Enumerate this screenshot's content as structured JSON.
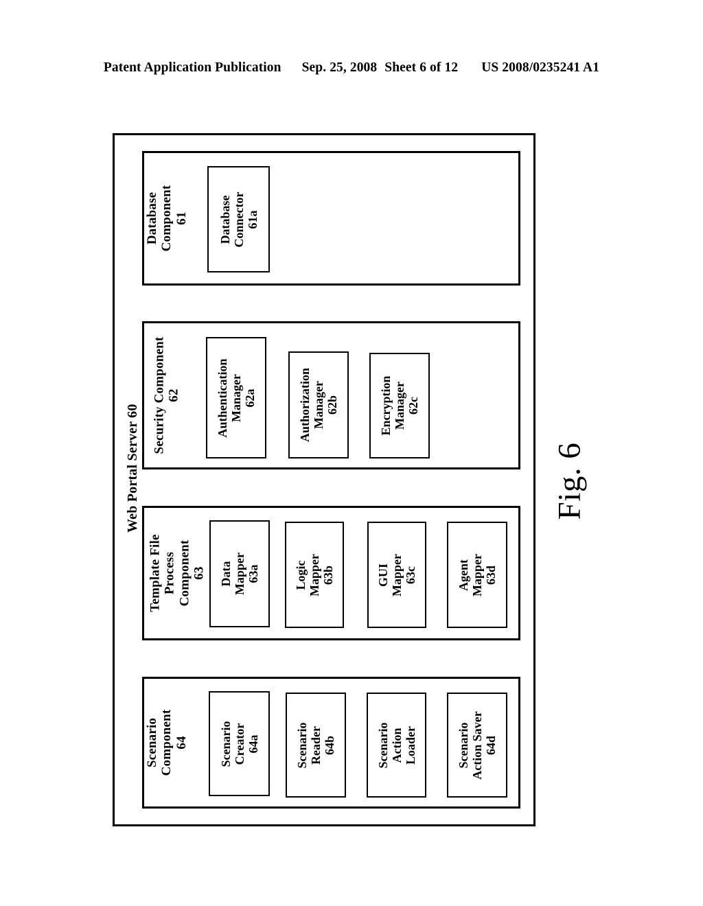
{
  "header": {
    "publication": "Patent Application Publication",
    "date": "Sep. 25, 2008",
    "sheet": "Sheet 6 of 12",
    "patent_number": "US 2008/0235241 A1"
  },
  "figure": {
    "caption": "Fig. 6",
    "outer_title": "Web Portal Server 60",
    "line_color": "#000000",
    "background": "#ffffff"
  },
  "sections": [
    {
      "title": "Database\nComponent\n61",
      "boxes": [
        {
          "label": "Database\nConnector\n61a"
        }
      ]
    },
    {
      "title": "Security Component\n62",
      "boxes": [
        {
          "label": "Authentication\nManager\n62a"
        },
        {
          "label": "Authorization\nManager\n62b"
        },
        {
          "label": "Encryption\nManager\n62c"
        }
      ]
    },
    {
      "title": "Template File\nProcess\nComponent\n63",
      "boxes": [
        {
          "label": "Data\nMapper\n63a"
        },
        {
          "label": "Logic\nMapper\n63b"
        },
        {
          "label": "GUI\nMapper\n63c"
        },
        {
          "label": "Agent\nMapper\n63d"
        }
      ]
    },
    {
      "title": "Scenario\nComponent\n64",
      "boxes": [
        {
          "label": "Scenario\nCreator\n64a"
        },
        {
          "label": "Scenario\nReader\n64b"
        },
        {
          "label": "Scenario\nAction\nLoader"
        },
        {
          "label": "Scenario\nAction Saver\n64d"
        }
      ]
    }
  ]
}
